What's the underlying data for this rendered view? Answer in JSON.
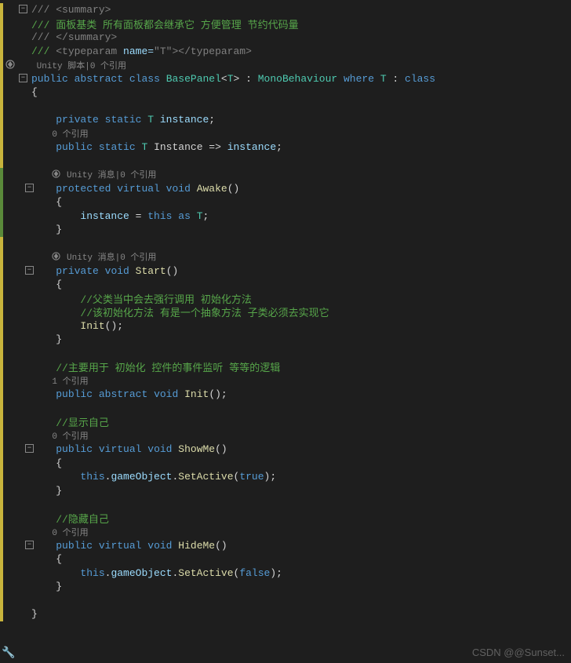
{
  "doc_summary": {
    "open": "/// <summary>",
    "line1": "/// 面板基类 所有面板都会继承它 方便管理 节约代码量",
    "close": "/// </summary>",
    "typeparam_prefix": "/// ",
    "typeparam_open": "<typeparam",
    "typeparam_attr": " name=",
    "typeparam_val": "\"T\"",
    "typeparam_mid": ">",
    "typeparam_close": "</typeparam>"
  },
  "codelens": {
    "unity_script": " Unity 脚本",
    "sep": "|",
    "refs0": "0 个引用",
    "refs1": "1 个引用",
    "unity_msg": " Unity 消息"
  },
  "class_decl": {
    "kw_public": "public",
    "kw_abstract": "abstract",
    "kw_class": "class",
    "name": "BasePanel",
    "lt": "<",
    "tparam": "T",
    "gt": ">",
    "colon": " : ",
    "base": "MonoBehaviour",
    "kw_where": "where",
    "tparam2": "T",
    "colon2": " : ",
    "kw_classc": "class"
  },
  "brace_open": "{",
  "brace_close": "}",
  "field_instance": {
    "kw_private": "private",
    "kw_static": "static",
    "type": "T",
    "name": " instance",
    "semi": ";"
  },
  "prop_instance": {
    "kw_public": "public",
    "kw_static": "static",
    "type": "T",
    "name": " Instance ",
    "arrow": "=>",
    "expr": " instance",
    "semi": ";"
  },
  "awake": {
    "kw_protected": "protected",
    "kw_virtual": "virtual",
    "kw_void": "void",
    "name": "Awake",
    "parens": "()",
    "body_assign": "instance ",
    "eq": "= ",
    "kw_this": "this",
    "kw_as": " as ",
    "t": "T",
    "semi": ";"
  },
  "start": {
    "kw_private": "private",
    "kw_void": "void",
    "name": "Start",
    "parens": "()",
    "comment1": "//父类当中会去强行调用 初始化方法",
    "comment2": "//该初始化方法 有是一个抽象方法 子类必须去实现它",
    "call": "Init",
    "call_parens": "();"
  },
  "init": {
    "comment": "//主要用于 初始化 控件的事件监听 等等的逻辑",
    "kw_public": "public",
    "kw_abstract": "abstract",
    "kw_void": "void",
    "name": "Init",
    "parens": "();"
  },
  "showme": {
    "comment": "//显示自己",
    "kw_public": "public",
    "kw_virtual": "virtual",
    "kw_void": "void",
    "name": "ShowMe",
    "parens": "()",
    "kw_this": "this",
    "dot": ".",
    "gameobj": "gameObject",
    "setactive": "SetActive",
    "arg_true": "true",
    "paren_open": "(",
    "paren_close": ");"
  },
  "hideme": {
    "comment": "//隐藏自己",
    "kw_public": "public",
    "kw_virtual": "virtual",
    "kw_void": "void",
    "name": "HideMe",
    "parens": "()",
    "kw_this": "this",
    "dot": ".",
    "gameobj": "gameObject",
    "setactive": "SetActive",
    "arg_false": "false",
    "paren_open": "(",
    "paren_close": ");"
  },
  "watermark": "CSDN @@Sunset..."
}
